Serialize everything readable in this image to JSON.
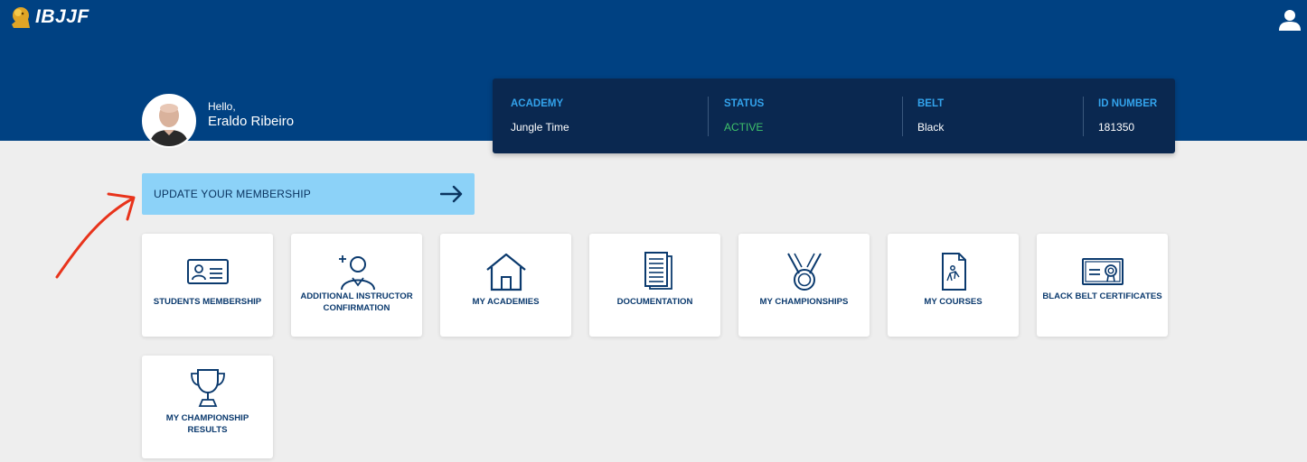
{
  "header": {
    "logo_text": "IBJJF",
    "user_menu_icon": "user-icon"
  },
  "profile": {
    "greeting": "Hello,",
    "name": "Eraldo Ribeiro"
  },
  "info_card": {
    "academy_label": "ACADEMY",
    "academy_value": "Jungle Time",
    "status_label": "STATUS",
    "status_value": "ACTIVE",
    "belt_label": "BELT",
    "belt_value": "Black",
    "id_label": "ID NUMBER",
    "id_value": "181350"
  },
  "update_button": {
    "label": "UPDATE YOUR MEMBERSHIP",
    "icon": "arrow-right-icon"
  },
  "tiles": [
    {
      "label": "STUDENTS MEMBERSHIP",
      "icon": "id-card-icon"
    },
    {
      "label": "ADDITIONAL INSTRUCTOR CONFIRMATION",
      "icon": "add-instructor-icon"
    },
    {
      "label": "MY ACADEMIES",
      "icon": "house-icon"
    },
    {
      "label": "DOCUMENTATION",
      "icon": "documents-icon"
    },
    {
      "label": "MY CHAMPIONSHIPS",
      "icon": "medal-icon"
    },
    {
      "label": "MY COURSES",
      "icon": "course-document-icon"
    },
    {
      "label": "BLACK BELT CERTIFICATES",
      "icon": "certificate-icon"
    },
    {
      "label": "MY CHAMPIONSHIP RESULTS",
      "icon": "trophy-icon"
    }
  ],
  "colors": {
    "header_blue": "#004182",
    "card_navy": "#0a2850",
    "accent_blue": "#33a3ec",
    "status_green": "#3fc26a",
    "button_light_blue": "#8cd2f8",
    "annotation_red": "#e8331b"
  }
}
